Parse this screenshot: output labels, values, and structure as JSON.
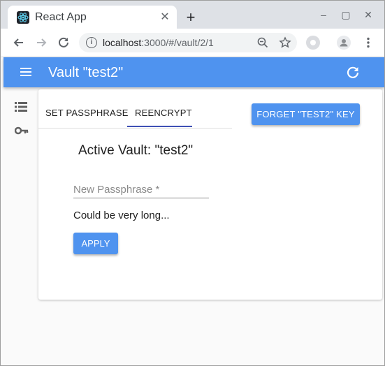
{
  "browser": {
    "tab_title": "React App",
    "tab_close": "✕",
    "new_tab": "+",
    "url_host": "localhost",
    "url_path": ":3000/#/vault/2/1",
    "window_controls": {
      "minimize": "–",
      "maximize": "▢",
      "close": "✕"
    }
  },
  "appbar": {
    "title": "Vault \"test2\"",
    "color": "#4f93ef"
  },
  "tabs": [
    {
      "label": "SET PASSPHRASE",
      "active": false
    },
    {
      "label": "REENCRYPT",
      "active": true
    }
  ],
  "forget_button": "FORGET \"TEST2\" KEY",
  "heading": "Active Vault: \"test2\"",
  "passphrase_input": {
    "placeholder": "New Passphrase *",
    "value": ""
  },
  "hint": "Could be very long...",
  "apply_button": "APPLY",
  "colors": {
    "accent": "#4f93ef",
    "indicator": "#3f51b5"
  },
  "icons": [
    "react-logo-icon",
    "info-icon",
    "zoom-out-icon",
    "star-icon",
    "extension-icon",
    "profile-icon",
    "kebab-menu-icon",
    "hamburger-icon",
    "refresh-icon",
    "list-icon",
    "key-icon"
  ]
}
